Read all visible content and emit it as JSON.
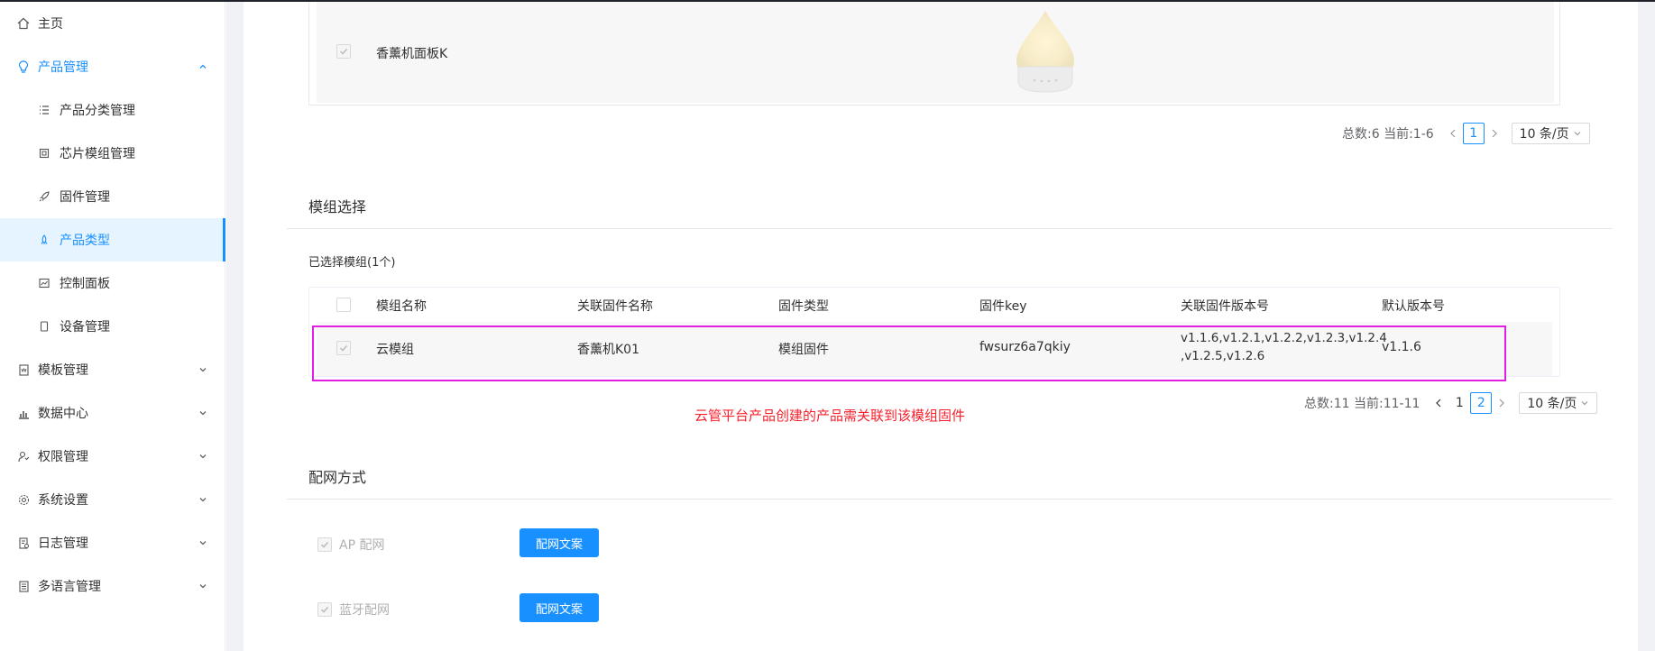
{
  "sidebar": {
    "items": [
      {
        "label": "主页",
        "icon": "home-icon"
      },
      {
        "label": "产品管理",
        "icon": "lightbulb-icon"
      },
      {
        "label": "产品分类管理",
        "icon": "list-icon"
      },
      {
        "label": "芯片模组管理",
        "icon": "chip-icon"
      },
      {
        "label": "固件管理",
        "icon": "rocket-icon"
      },
      {
        "label": "产品类型",
        "icon": "rocket-icon"
      },
      {
        "label": "控制面板",
        "icon": "chart-icon"
      },
      {
        "label": "设备管理",
        "icon": "device-icon"
      },
      {
        "label": "模板管理",
        "icon": "template-icon"
      },
      {
        "label": "数据中心",
        "icon": "bar-chart-icon"
      },
      {
        "label": "权限管理",
        "icon": "user-permission-icon"
      },
      {
        "label": "系统设置",
        "icon": "gear-icon"
      },
      {
        "label": "日志管理",
        "icon": "log-icon"
      },
      {
        "label": "多语言管理",
        "icon": "language-icon"
      }
    ]
  },
  "top_table": {
    "row_name": "香薰机面板K"
  },
  "pager1": {
    "summary": "总数:6 当前:1-6",
    "page": "1",
    "size": "10 条/页"
  },
  "module_section": {
    "title": "模组选择",
    "selected": "已选择模组(1个)",
    "columns": [
      "模组名称",
      "关联固件名称",
      "固件类型",
      "固件key",
      "关联固件版本号",
      "默认版本号"
    ],
    "row": {
      "name": "云模组",
      "firmware_name": "香薰机K01",
      "firmware_type": "模组固件",
      "firmware_key": "fwsurz6a7qkiy",
      "versions_line1": "v1.1.6,v1.2.1,v1.2.2,v1.2.3,v1.2.4",
      "versions_line2": ",v1.2.5,v1.2.6",
      "default_version": "v1.1.6"
    }
  },
  "pager2": {
    "summary": "总数:11 当前:11-11",
    "page1": "1",
    "page2": "2",
    "size": "10 条/页"
  },
  "note": "云管平台产品创建的产品需关联到该模组固件",
  "network_section": {
    "title": "配网方式",
    "options": [
      {
        "label": "AP 配网",
        "button": "配网文案"
      },
      {
        "label": "蓝牙配网",
        "button": "配网文案"
      }
    ]
  },
  "colors": {
    "accent": "#1890ff",
    "highlight": "#e020e0",
    "note": "#f5222d"
  }
}
